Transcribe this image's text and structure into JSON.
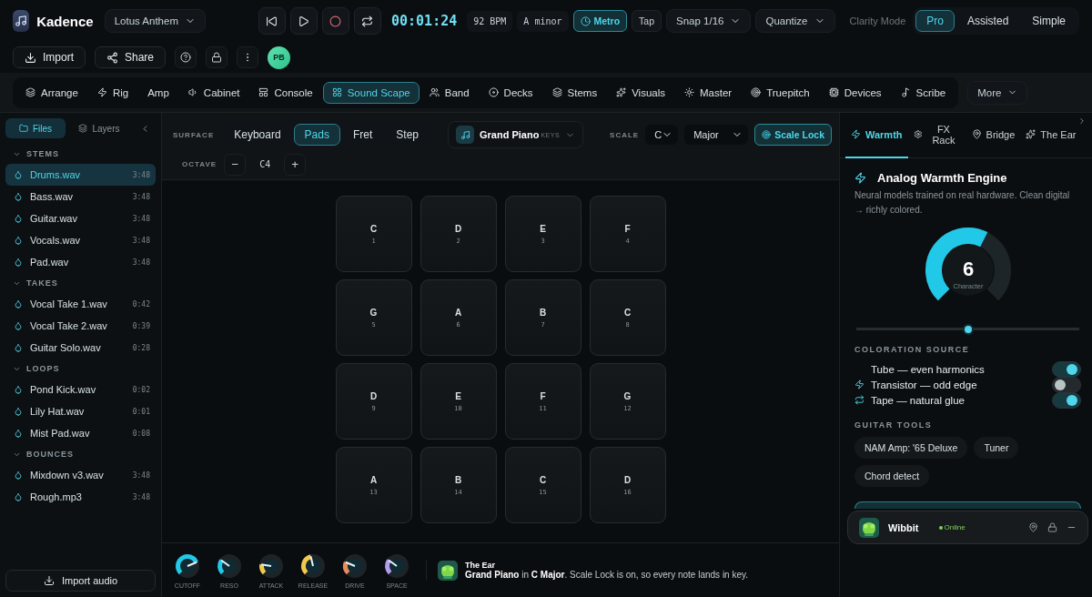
{
  "app": {
    "name": "Kadence",
    "project": "Lotus Anthem"
  },
  "transport": {
    "time": "00:01:24",
    "bpm": "92 BPM",
    "key": "A minor",
    "metro": {
      "label": "Metro",
      "on": true
    },
    "tap": "Tap",
    "snap": "Snap 1/16",
    "quantize": "Quantize"
  },
  "clarity": {
    "label": "Clarity Mode",
    "options": [
      {
        "label": "Pro",
        "selected": true
      },
      {
        "label": "Assisted",
        "selected": false
      },
      {
        "label": "Simple",
        "selected": false
      }
    ]
  },
  "actions": {
    "import": "Import",
    "share": "Share",
    "avatar": "PB"
  },
  "nav": [
    {
      "label": "Arrange",
      "selected": false
    },
    {
      "label": "Rig",
      "selected": false
    },
    {
      "label": "Amp",
      "selected": false
    },
    {
      "label": "Cabinet",
      "selected": false
    },
    {
      "label": "Console",
      "selected": false
    },
    {
      "label": "Sound Scape",
      "selected": true
    },
    {
      "label": "Band",
      "selected": false
    },
    {
      "label": "Decks",
      "selected": false
    },
    {
      "label": "Stems",
      "selected": false
    },
    {
      "label": "Visuals",
      "selected": false
    },
    {
      "label": "Master",
      "selected": false
    },
    {
      "label": "Truepitch",
      "selected": false
    },
    {
      "label": "Devices",
      "selected": false
    },
    {
      "label": "Scribe",
      "selected": false
    }
  ],
  "nav_more": "More",
  "sidebar": {
    "tabs": [
      {
        "label": "Files",
        "selected": true
      },
      {
        "label": "Layers",
        "selected": false
      }
    ],
    "sections": [
      {
        "title": "STEMS",
        "expanded": true,
        "children": [
          {
            "name": "Drums.wav",
            "time": "3:48",
            "selected": true
          },
          {
            "name": "Bass.wav",
            "time": "3:48",
            "selected": false
          },
          {
            "name": "Guitar.wav",
            "time": "3:48",
            "selected": false
          },
          {
            "name": "Vocals.wav",
            "time": "3:48",
            "selected": false
          },
          {
            "name": "Pad.wav",
            "time": "3:48",
            "selected": false
          }
        ]
      },
      {
        "title": "TAKES",
        "expanded": true,
        "children": [
          {
            "name": "Vocal Take 1.wav",
            "time": "0:42",
            "selected": false
          },
          {
            "name": "Vocal Take 2.wav",
            "time": "0:39",
            "selected": false
          },
          {
            "name": "Guitar Solo.wav",
            "time": "0:28",
            "selected": false
          }
        ]
      },
      {
        "title": "LOOPS",
        "expanded": true,
        "children": [
          {
            "name": "Pond Kick.wav",
            "time": "0:02",
            "selected": false
          },
          {
            "name": "Lily Hat.wav",
            "time": "0:01",
            "selected": false
          },
          {
            "name": "Mist Pad.wav",
            "time": "0:08",
            "selected": false
          }
        ]
      },
      {
        "title": "BOUNCES",
        "expanded": true,
        "children": [
          {
            "name": "Mixdown v3.wav",
            "time": "3:48",
            "selected": false
          },
          {
            "name": "Rough.mp3",
            "time": "3:48",
            "selected": false
          }
        ]
      }
    ],
    "import_button": "Import audio"
  },
  "surface": {
    "label": "SURFACE",
    "modes": [
      {
        "label": "Keyboard",
        "selected": false
      },
      {
        "label": "Pads",
        "selected": true
      },
      {
        "label": "Fret",
        "selected": false
      },
      {
        "label": "Step",
        "selected": false
      }
    ],
    "instrument": {
      "name": "Grand Piano",
      "tag": "KEYS"
    },
    "scale": {
      "label": "SCALE",
      "root": "C",
      "mode": "Major",
      "lock": {
        "label": "Scale Lock",
        "on": true
      }
    },
    "octave": {
      "label": "OCTAVE",
      "value": "C4",
      "minus": "−",
      "plus": "+"
    }
  },
  "pads": [
    {
      "note": "C",
      "number": "1"
    },
    {
      "note": "D",
      "number": "2"
    },
    {
      "note": "E",
      "number": "3"
    },
    {
      "note": "F",
      "number": "4"
    },
    {
      "note": "G",
      "number": "5"
    },
    {
      "note": "A",
      "number": "6"
    },
    {
      "note": "B",
      "number": "7"
    },
    {
      "note": "C",
      "number": "8"
    },
    {
      "note": "D",
      "number": "9"
    },
    {
      "note": "E",
      "number": "10"
    },
    {
      "note": "F",
      "number": "11"
    },
    {
      "note": "G",
      "number": "12"
    },
    {
      "note": "A",
      "number": "13"
    },
    {
      "note": "B",
      "number": "14"
    },
    {
      "note": "C",
      "number": "15"
    },
    {
      "note": "D",
      "number": "16"
    }
  ],
  "knobs": [
    {
      "label": "CUTOFF",
      "color": "#22c8e8"
    },
    {
      "label": "RESO",
      "color": "#22c8e8"
    },
    {
      "label": "ATTACK",
      "color": "#f2c94c"
    },
    {
      "label": "RELEASE",
      "color": "#f2c94c"
    },
    {
      "label": "DRIVE",
      "color": "#e88a5a"
    },
    {
      "label": "SPACE",
      "color": "#b59cf0"
    }
  ],
  "ear_message": {
    "title": "The Ear",
    "text": "**Grand Piano** in **C Major**. Scale Lock is on, so every note lands in key."
  },
  "right_panel": {
    "tabs": [
      {
        "label": "Warmth",
        "selected": true
      },
      {
        "label": "FX Rack",
        "selected": false
      },
      {
        "label": "Bridge",
        "selected": false
      },
      {
        "label": "The Ear",
        "selected": false
      }
    ],
    "title": "Analog Warmth Engine",
    "description": "Neural models trained on real hardware. Clean digital → richly colored.",
    "gauge": {
      "value": "6",
      "label": "Character"
    },
    "slider": {
      "level": 0.5
    },
    "coloration_title": "COLORATION SOURCE",
    "sources": [
      {
        "label": "Tube — even harmonics",
        "on": true
      },
      {
        "label": "Transistor — odd edge",
        "on": false
      },
      {
        "label": "Tape — natural glue",
        "on": true
      }
    ],
    "guitar_title": "GUITAR TOOLS",
    "guitar_tools": [
      "NAM Amp: '65 Deluxe",
      "Tuner",
      "Chord detect"
    ]
  },
  "assistant": {
    "name": "Wibbit",
    "status": "Online"
  }
}
